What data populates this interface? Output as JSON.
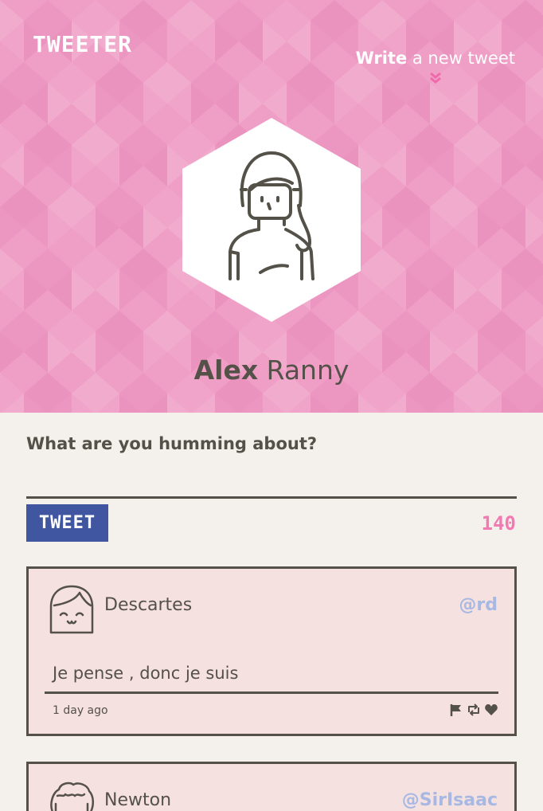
{
  "nav": {
    "brand": "TWEETER",
    "compose_link_bold": "Write",
    "compose_link_rest": " a new tweet"
  },
  "profile": {
    "first_name": "Alex",
    "last_name": " Ranny"
  },
  "compose": {
    "label": "What are you humming about?",
    "placeholder": "",
    "button_label": "TWEET",
    "counter": "140"
  },
  "tweets": [
    {
      "author": "Descartes",
      "handle": "@rd",
      "text": "Je pense , donc je suis",
      "age": "1 day ago"
    },
    {
      "author": "Newton",
      "handle": "@SirIsaac"
    }
  ],
  "colors": {
    "header_bg": "#ef9ec6",
    "page_bg": "#f4f0eb",
    "tweet_bg": "#f6e1e1",
    "button_bg": "#4056a1",
    "counter": "#f27ab2",
    "handle": "#a7b9e3",
    "text": "#545149"
  },
  "icons": [
    "chevron-double-down-icon",
    "user-avatar-icon",
    "flag-icon",
    "retweet-icon",
    "heart-icon"
  ]
}
